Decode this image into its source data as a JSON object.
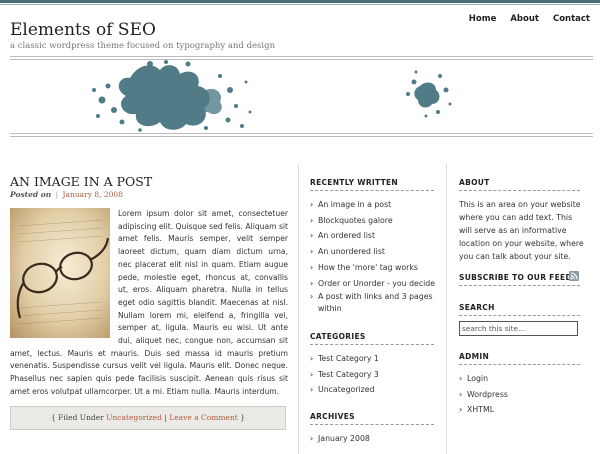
{
  "header": {
    "title": "Elements of SEO",
    "tagline": "a classic wordpress theme focused on typography and design",
    "nav": [
      "Home",
      "About",
      "Contact"
    ]
  },
  "post": {
    "title": "AN IMAGE IN A POST",
    "posted_on": "Posted on",
    "date": "January 8, 2008",
    "body": "Lorem ipsum dolor sit amet, consectetuer adipiscing elit. Quisque sed felis. Aliquam sit amet felis. Mauris semper, velit semper laoreet dictum, quam diam dictum urna, nec placerat elit nisl in quam. Etiam augue pede, molestie eget, rhoncus at, convallis ut, eros. Aliquam pharetra. Nulla in tellus eget odio sagittis blandit. Maecenas at nisl. Nullam lorem mi, eleifend a, fringilla vel, semper at, ligula. Mauris eu wisi. Ut ante dui, aliquet nec, congue non, accumsan sit amet, lectus. Mauris et mauris. Duis sed massa id mauris pretium venenatis. Suspendisse cursus velit vel ligula. Mauris elit. Donec neque. Phasellus nec sapien quis pede facilisis suscipit. Aenean quis risus sit amet eros volutpat ullamcorper. Ut a mi. Etiam nulla. Mauris interdum.",
    "filed_prefix": "{ Filed Under",
    "category": "Uncategorized",
    "divider": "|",
    "comment_link": "Leave a Comment",
    "filed_suffix": "}"
  },
  "sidebar_left": {
    "recently_written": {
      "title": "RECENTLY WRITTEN",
      "items": [
        "An image in a post",
        "Blockquotes galore",
        "An ordered list",
        "An unordered list",
        "How the 'more' tag works",
        "Order or Unorder - you decide",
        "A post with links and 3 pages within"
      ]
    },
    "categories": {
      "title": "CATEGORIES",
      "items": [
        "Test Category 1",
        "Test Category 3",
        "Uncategorized"
      ]
    },
    "archives": {
      "title": "ARCHIVES",
      "items": [
        "January 2008"
      ]
    }
  },
  "sidebar_right": {
    "about": {
      "title": "ABOUT",
      "text": "This is an area on your website where you can add text. This will serve as an informative location on your website, where you can talk about your site."
    },
    "subscribe": {
      "title": "SUBSCRIBE TO OUR FEED",
      "icon": "rss-icon"
    },
    "search": {
      "title": "SEARCH",
      "value": "search this site..."
    },
    "admin": {
      "title": "ADMIN",
      "items": [
        "Login",
        "Wordpress",
        "XHTML"
      ]
    }
  },
  "colors": {
    "accent": "#b05a3c",
    "splash": "#3f6d7a",
    "top_bar": "#4a6a74"
  }
}
